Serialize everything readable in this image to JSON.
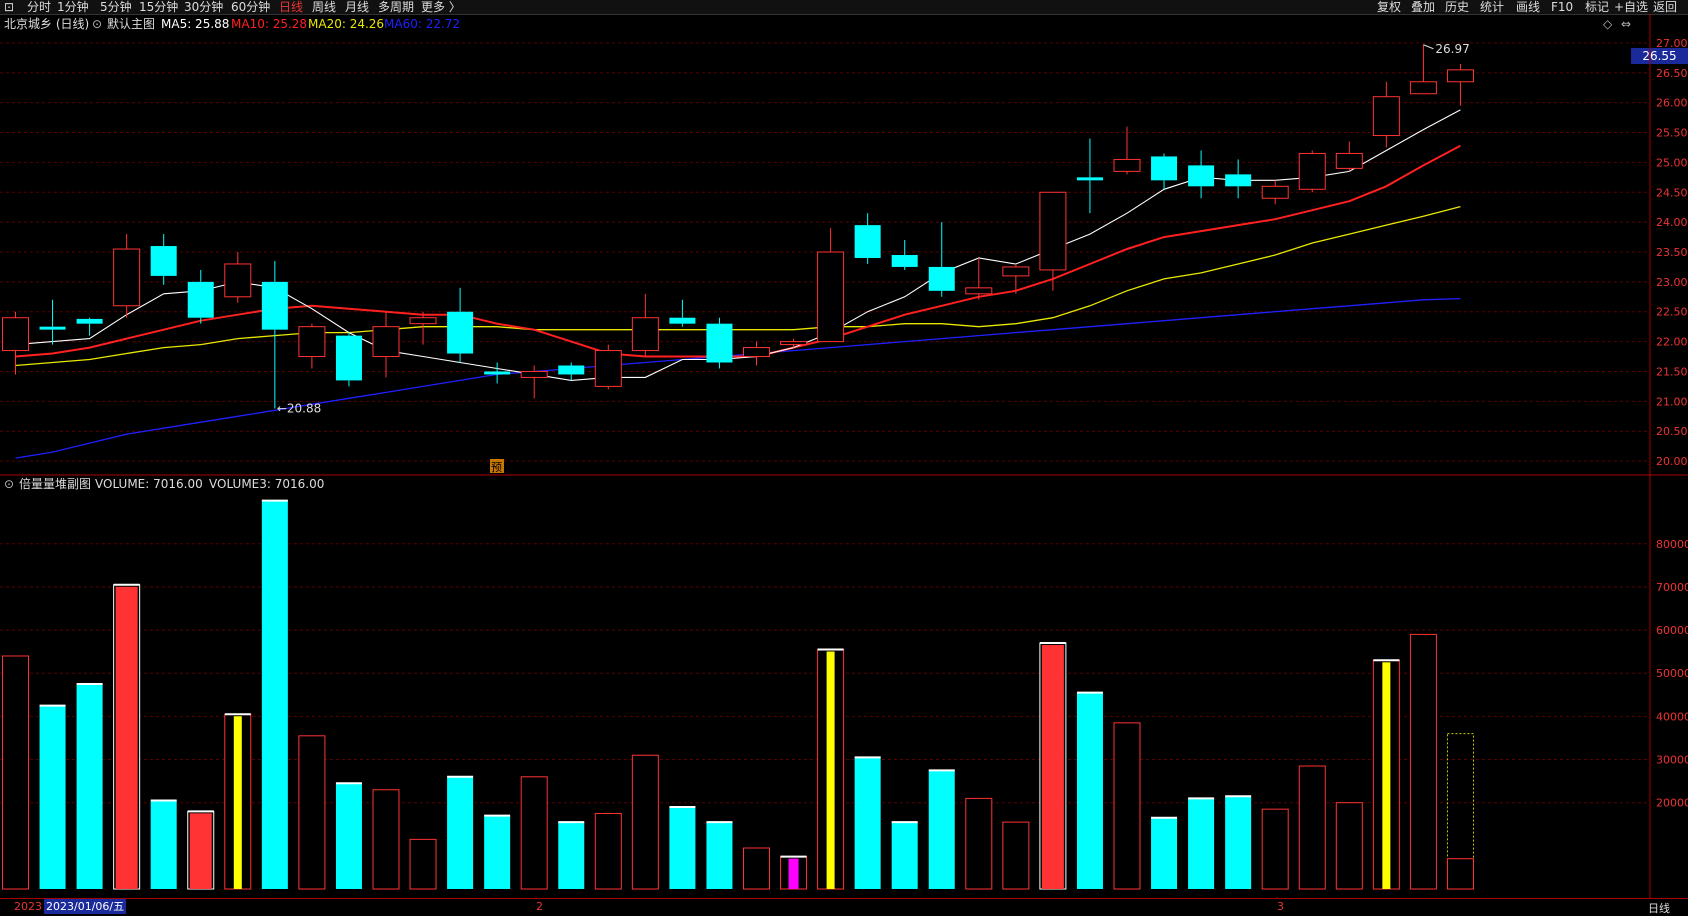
{
  "toolbar": {
    "left_items": [
      "分时",
      "1分钟",
      "5分钟",
      "15分钟",
      "30分钟",
      "60分钟",
      "日线",
      "周线",
      "月线",
      "多周期",
      "更多 〉"
    ],
    "active": "日线",
    "right_items": [
      "复权",
      "叠加",
      "历史",
      "统计",
      "画线",
      "F10",
      "标记",
      "+自选",
      "返回"
    ]
  },
  "main": {
    "stock_title": "北京城乡 (日线)",
    "chart_name": "默认主图",
    "ma5": "MA5: 25.88",
    "ma10": "MA10: 25.28",
    "ma20": "MA20: 24.26",
    "ma60": "MA60: 22.72",
    "current_price": "26.55",
    "high_label": "26.97",
    "low_label": "20.88",
    "pre_label": "预",
    "y_ticks": [
      "27.00",
      "26.50",
      "26.00",
      "25.50",
      "25.00",
      "24.50",
      "24.00",
      "23.50",
      "23.00",
      "22.50",
      "22.00",
      "21.50",
      "21.00",
      "20.50",
      "20.00"
    ]
  },
  "sub": {
    "title": "倍量量堆副图",
    "volume": "VOLUME: 7016.00",
    "volume3": "VOLUME3: 7016.00",
    "y_ticks": [
      "80000",
      "70000",
      "60000",
      "50000",
      "40000",
      "30000",
      "20000"
    ]
  },
  "bottom": {
    "year": "2023",
    "date": "2023/01/06/五",
    "month2": "2",
    "month3": "3",
    "period": "日线"
  },
  "colors": {
    "up": "#ff3333",
    "down": "#00ffff",
    "ma5": "#ffffff",
    "ma10": "#ff2020",
    "ma20": "#e8e800",
    "ma60": "#2020ff"
  },
  "chart_data": {
    "type": "candlestick",
    "price_ylim": [
      19.8,
      27.15
    ],
    "volume_ylim": [
      0,
      92000
    ],
    "candles": [
      {
        "o": 21.85,
        "h": 22.5,
        "l": 21.45,
        "c": 22.4,
        "dir": "up",
        "vol": 54000
      },
      {
        "o": 22.2,
        "h": 22.7,
        "l": 21.95,
        "c": 22.25,
        "dir": "down",
        "vol": 42500
      },
      {
        "o": 22.3,
        "h": 22.4,
        "l": 22.1,
        "c": 22.38,
        "dir": "down",
        "vol": 47500
      },
      {
        "o": 22.6,
        "h": 23.8,
        "l": 22.4,
        "c": 23.55,
        "dir": "up",
        "vol": 70500
      },
      {
        "o": 23.6,
        "h": 23.8,
        "l": 22.95,
        "c": 23.1,
        "dir": "down",
        "vol": 20500
      },
      {
        "o": 23.0,
        "h": 23.2,
        "l": 22.3,
        "c": 22.4,
        "dir": "down",
        "vol": 18000
      },
      {
        "o": 22.75,
        "h": 23.5,
        "l": 22.65,
        "c": 23.3,
        "dir": "up",
        "vol": 40500
      },
      {
        "o": 23.0,
        "h": 23.35,
        "l": 20.88,
        "c": 22.2,
        "dir": "down",
        "vol": 90000
      },
      {
        "o": 21.75,
        "h": 22.3,
        "l": 21.55,
        "c": 22.25,
        "dir": "up",
        "vol": 35500
      },
      {
        "o": 22.1,
        "h": 22.15,
        "l": 21.25,
        "c": 21.35,
        "dir": "down",
        "vol": 24500
      },
      {
        "o": 21.75,
        "h": 22.5,
        "l": 21.4,
        "c": 22.25,
        "dir": "up",
        "vol": 23000
      },
      {
        "o": 22.3,
        "h": 22.5,
        "l": 21.95,
        "c": 22.4,
        "dir": "up",
        "vol": 11500
      },
      {
        "o": 22.5,
        "h": 22.9,
        "l": 21.65,
        "c": 21.8,
        "dir": "down",
        "vol": 26000
      },
      {
        "o": 21.5,
        "h": 21.65,
        "l": 21.3,
        "c": 21.45,
        "dir": "down",
        "vol": 17000
      },
      {
        "o": 21.4,
        "h": 21.6,
        "l": 21.05,
        "c": 21.5,
        "dir": "up",
        "vol": 26000
      },
      {
        "o": 21.6,
        "h": 21.65,
        "l": 21.35,
        "c": 21.45,
        "dir": "down",
        "vol": 15500
      },
      {
        "o": 21.25,
        "h": 21.95,
        "l": 21.2,
        "c": 21.85,
        "dir": "up",
        "vol": 17500
      },
      {
        "o": 21.85,
        "h": 22.8,
        "l": 21.75,
        "c": 22.4,
        "dir": "up",
        "vol": 31000
      },
      {
        "o": 22.4,
        "h": 22.7,
        "l": 22.25,
        "c": 22.3,
        "dir": "down",
        "vol": 19000
      },
      {
        "o": 22.3,
        "h": 22.4,
        "l": 21.55,
        "c": 21.65,
        "dir": "down",
        "vol": 15500
      },
      {
        "o": 21.75,
        "h": 22.0,
        "l": 21.6,
        "c": 21.9,
        "dir": "up",
        "vol": 9500
      },
      {
        "o": 21.95,
        "h": 22.05,
        "l": 21.9,
        "c": 22.0,
        "dir": "up",
        "vol": 7500
      },
      {
        "o": 22.0,
        "h": 23.9,
        "l": 22.0,
        "c": 23.5,
        "dir": "up",
        "vol": 55500
      },
      {
        "o": 23.95,
        "h": 24.15,
        "l": 23.3,
        "c": 23.4,
        "dir": "down",
        "vol": 30500
      },
      {
        "o": 23.45,
        "h": 23.7,
        "l": 23.2,
        "c": 23.25,
        "dir": "down",
        "vol": 15500
      },
      {
        "o": 23.25,
        "h": 24.0,
        "l": 22.75,
        "c": 22.85,
        "dir": "down",
        "vol": 27500
      },
      {
        "o": 22.8,
        "h": 23.4,
        "l": 22.7,
        "c": 22.9,
        "dir": "up",
        "vol": 21000
      },
      {
        "o": 23.1,
        "h": 23.3,
        "l": 22.8,
        "c": 23.25,
        "dir": "up",
        "vol": 15500
      },
      {
        "o": 23.2,
        "h": 24.5,
        "l": 22.85,
        "c": 24.5,
        "dir": "up",
        "vol": 57000
      },
      {
        "o": 24.75,
        "h": 25.4,
        "l": 24.15,
        "c": 24.7,
        "dir": "down",
        "vol": 45500
      },
      {
        "o": 24.85,
        "h": 25.6,
        "l": 24.8,
        "c": 25.05,
        "dir": "up",
        "vol": 38500
      },
      {
        "o": 25.1,
        "h": 25.15,
        "l": 24.55,
        "c": 24.7,
        "dir": "down",
        "vol": 16500
      },
      {
        "o": 24.95,
        "h": 25.2,
        "l": 24.4,
        "c": 24.6,
        "dir": "down",
        "vol": 21000
      },
      {
        "o": 24.8,
        "h": 25.05,
        "l": 24.4,
        "c": 24.6,
        "dir": "down",
        "vol": 21500
      },
      {
        "o": 24.4,
        "h": 24.7,
        "l": 24.3,
        "c": 24.6,
        "dir": "up",
        "vol": 18500
      },
      {
        "o": 24.55,
        "h": 25.2,
        "l": 24.5,
        "c": 25.15,
        "dir": "up",
        "vol": 28500
      },
      {
        "o": 24.9,
        "h": 25.35,
        "l": 24.85,
        "c": 25.15,
        "dir": "up",
        "vol": 20000
      },
      {
        "o": 25.45,
        "h": 26.35,
        "l": 25.25,
        "c": 26.1,
        "dir": "up",
        "vol": 53000
      },
      {
        "o": 26.15,
        "h": 26.97,
        "l": 26.15,
        "c": 26.35,
        "dir": "up",
        "vol": 59000
      },
      {
        "o": 26.35,
        "h": 26.65,
        "l": 25.95,
        "c": 26.55,
        "dir": "up",
        "vol": 7016
      }
    ],
    "vol_mark_colors": [
      "up",
      "down",
      "down",
      "red",
      "down",
      "red",
      "yellow",
      "down",
      "up",
      "down",
      "up",
      "up",
      "down",
      "down",
      "up",
      "down",
      "up",
      "up",
      "down",
      "down",
      "up",
      "magenta",
      "yellow",
      "down",
      "down",
      "down",
      "up",
      "up",
      "red",
      "down",
      "up",
      "down",
      "down",
      "down",
      "up",
      "up",
      "up",
      "yellow",
      "up",
      "dotted"
    ],
    "ma5": [
      21.95,
      22.0,
      22.05,
      22.45,
      22.8,
      22.85,
      23.0,
      22.9,
      22.55,
      22.15,
      21.85,
      21.75,
      21.65,
      21.55,
      21.45,
      21.35,
      21.4,
      21.4,
      21.7,
      21.7,
      21.75,
      21.9,
      22.15,
      22.5,
      22.75,
      23.15,
      23.4,
      23.3,
      23.55,
      23.8,
      24.15,
      24.55,
      24.75,
      24.7,
      24.7,
      24.75,
      24.85,
      25.2,
      25.55,
      25.88
    ],
    "ma10": [
      21.75,
      21.8,
      21.9,
      22.05,
      22.2,
      22.35,
      22.45,
      22.55,
      22.6,
      22.55,
      22.5,
      22.45,
      22.45,
      22.3,
      22.2,
      22.0,
      21.8,
      21.75,
      21.75,
      21.75,
      21.75,
      21.9,
      22.05,
      22.25,
      22.45,
      22.6,
      22.75,
      22.85,
      23.05,
      23.3,
      23.55,
      23.75,
      23.85,
      23.95,
      24.05,
      24.2,
      24.35,
      24.6,
      24.95,
      25.28
    ],
    "ma20": [
      21.6,
      21.65,
      21.7,
      21.8,
      21.9,
      21.95,
      22.05,
      22.1,
      22.15,
      22.15,
      22.2,
      22.25,
      22.25,
      22.25,
      22.2,
      22.2,
      22.2,
      22.2,
      22.2,
      22.2,
      22.2,
      22.2,
      22.25,
      22.25,
      22.3,
      22.3,
      22.25,
      22.3,
      22.4,
      22.6,
      22.85,
      23.05,
      23.15,
      23.3,
      23.45,
      23.65,
      23.8,
      23.95,
      24.1,
      24.26
    ],
    "ma60": [
      20.05,
      20.15,
      20.3,
      20.45,
      20.55,
      20.65,
      20.75,
      20.85,
      20.95,
      21.05,
      21.15,
      21.25,
      21.35,
      21.45,
      21.5,
      21.55,
      21.6,
      21.65,
      21.7,
      21.75,
      21.8,
      21.85,
      21.9,
      21.95,
      22.0,
      22.05,
      22.1,
      22.15,
      22.2,
      22.25,
      22.3,
      22.35,
      22.4,
      22.45,
      22.5,
      22.55,
      22.6,
      22.65,
      22.7,
      22.72
    ]
  }
}
